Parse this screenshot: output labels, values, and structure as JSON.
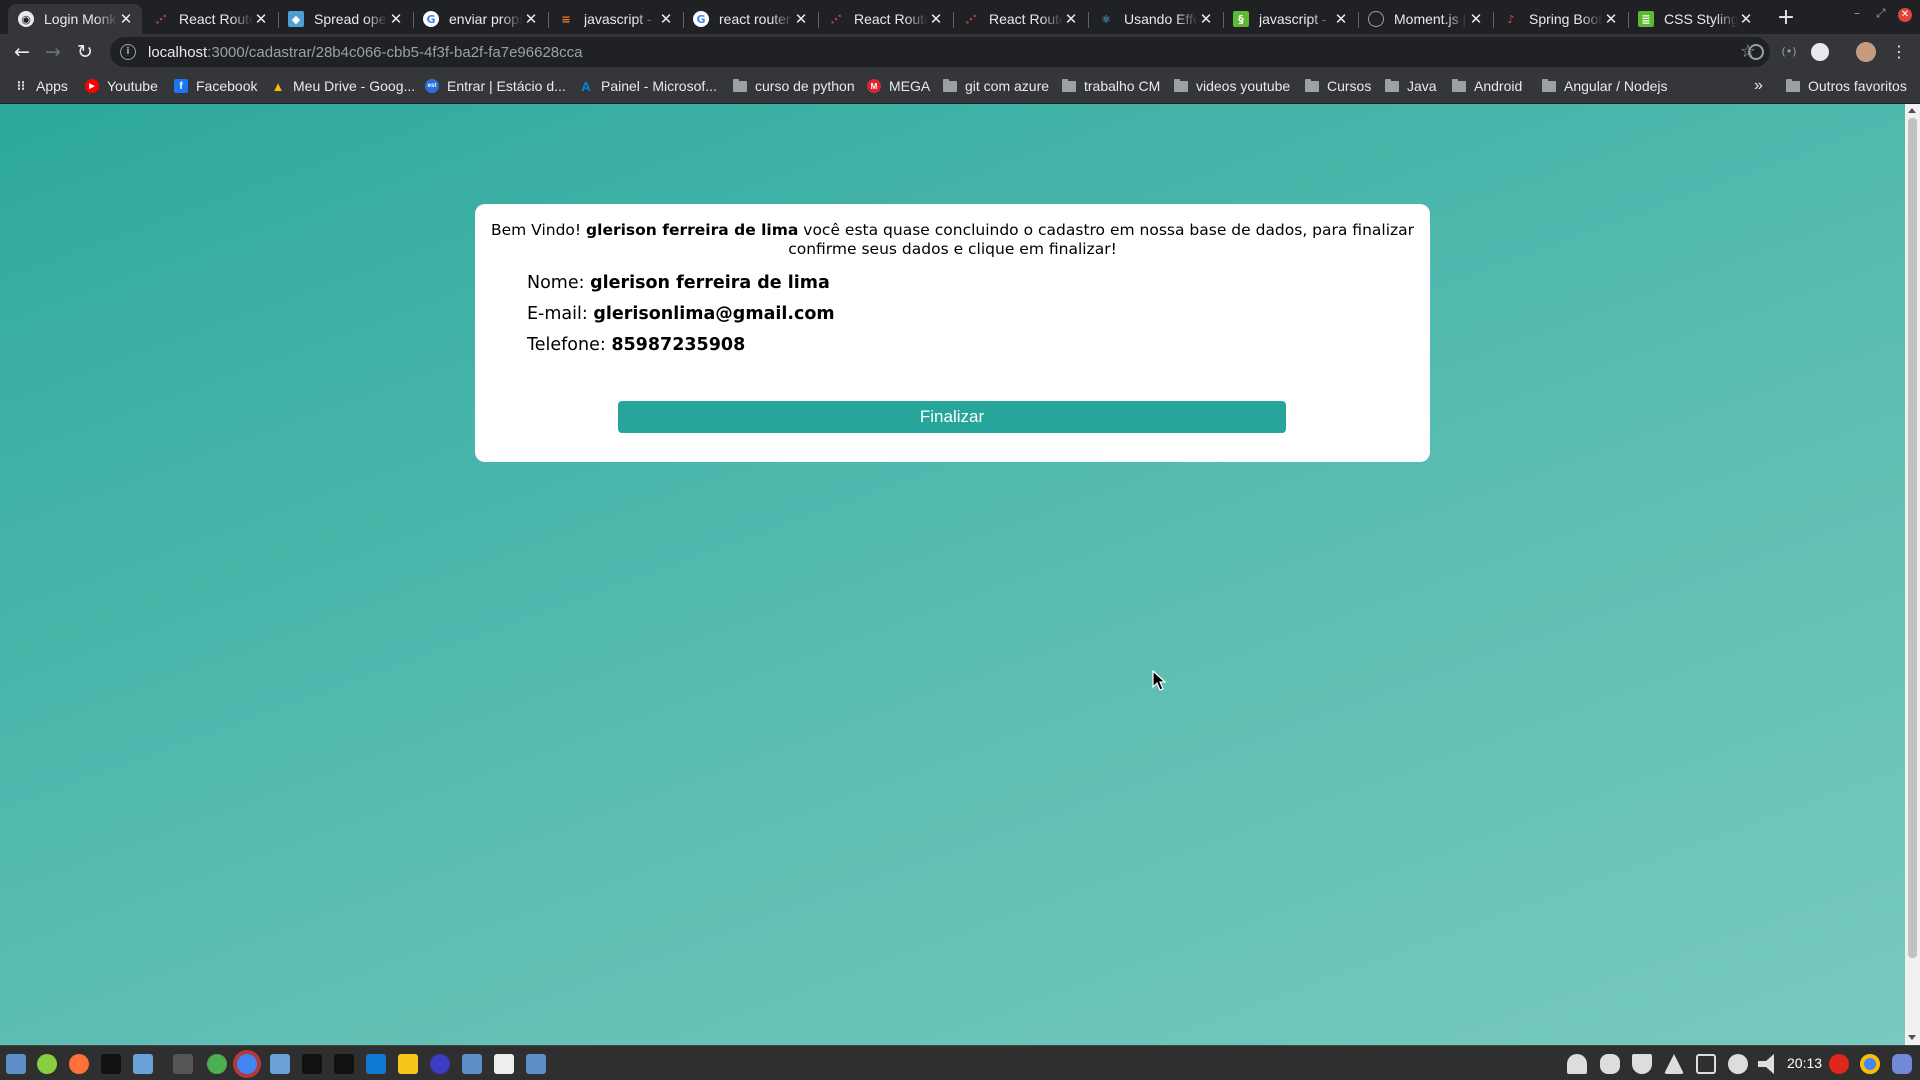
{
  "browser": {
    "tabs": [
      {
        "title": "Login Monkey",
        "active": true
      },
      {
        "title": "React Router"
      },
      {
        "title": "Spread operator"
      },
      {
        "title": "enviar props"
      },
      {
        "title": "javascript - Stack"
      },
      {
        "title": "react router"
      },
      {
        "title": "React Router"
      },
      {
        "title": "React Router"
      },
      {
        "title": "Usando Effect"
      },
      {
        "title": "javascript - Stack"
      },
      {
        "title": "Moment.js | Docs"
      },
      {
        "title": "Spring Boot"
      },
      {
        "title": "CSS Styling"
      }
    ],
    "url_host": "localhost",
    "url_path": ":3000/cadastrar/28b4c066-cbb5-4f3f-ba2f-fa7e96628cca",
    "bookmarks": [
      {
        "label": "Apps",
        "icon": "apps-grid-icon"
      },
      {
        "label": "Youtube",
        "icon": "youtube-icon"
      },
      {
        "label": "Facebook",
        "icon": "facebook-icon"
      },
      {
        "label": "Meu Drive - Goog...",
        "icon": "google-drive-icon"
      },
      {
        "label": "Entrar | Estácio d...",
        "icon": "estacio-icon"
      },
      {
        "label": "Painel - Microsof...",
        "icon": "azure-icon"
      },
      {
        "label": "curso de python",
        "icon": "folder-icon"
      },
      {
        "label": "MEGA",
        "icon": "mega-icon"
      },
      {
        "label": "git com azure",
        "icon": "folder-icon"
      },
      {
        "label": "trabalho CM",
        "icon": "folder-icon"
      },
      {
        "label": "videos youtube",
        "icon": "folder-icon"
      },
      {
        "label": "Cursos",
        "icon": "folder-icon"
      },
      {
        "label": "Java",
        "icon": "folder-icon"
      },
      {
        "label": "Android",
        "icon": "folder-icon"
      },
      {
        "label": "Angular / Nodejs",
        "icon": "folder-icon"
      }
    ],
    "more_bookmarks": "»",
    "other_bookmarks": "Outros favoritos"
  },
  "page": {
    "welcome_prefix": "Bem Vindo!",
    "user_name": "glerison ferreira de lima",
    "welcome_suffix": "você esta quase concluindo o cadastro em nossa base de dados, para finalizar confirme seus dados e clique em finalizar!",
    "name_label": "Nome:",
    "name_value": "glerison ferreira de lima",
    "email_label": "E-mail:",
    "email_value": "glerisonlima@gmail.com",
    "phone_label": "Telefone:",
    "phone_value": "85987235908",
    "submit_label": "Finalizar",
    "accent_color": "#26a69a"
  },
  "taskbar": {
    "clock": "20:13"
  }
}
